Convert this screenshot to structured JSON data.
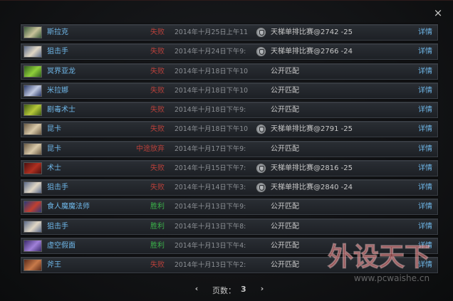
{
  "close_icon": "×",
  "matches": [
    {
      "hero": "斯拉克",
      "result": "失败",
      "result_type": "loss",
      "date": "2014年十月25日上午11:",
      "mode": "天梯单排比赛@2742 -25",
      "ranked": true,
      "detail": "详情",
      "avatar_colors": [
        "#3a5a3a",
        "#c8c29a"
      ]
    },
    {
      "hero": "狙击手",
      "result": "失败",
      "result_type": "loss",
      "date": "2014年十月24日下午9:",
      "mode": "天梯单排比赛@2766 -24",
      "ranked": true,
      "detail": "详情",
      "avatar_colors": [
        "#5a6a8a",
        "#e0d6c4"
      ]
    },
    {
      "hero": "冥界亚龙",
      "result": "失败",
      "result_type": "loss",
      "date": "2014年十月18日下午10",
      "mode": "公开匹配",
      "ranked": false,
      "detail": "详情",
      "avatar_colors": [
        "#2f5e1e",
        "#8fcf3a"
      ]
    },
    {
      "hero": "米拉娜",
      "result": "失败",
      "result_type": "loss",
      "date": "2014年十月18日下午10",
      "mode": "公开匹配",
      "ranked": false,
      "detail": "详情",
      "avatar_colors": [
        "#2a3a6a",
        "#c0c8e0"
      ]
    },
    {
      "hero": "剧毒术士",
      "result": "失败",
      "result_type": "loss",
      "date": "2014年十月18日下午9:",
      "mode": "公开匹配",
      "ranked": false,
      "detail": "详情",
      "avatar_colors": [
        "#3e5a14",
        "#b6c83a"
      ]
    },
    {
      "hero": "昆卡",
      "result": "失败",
      "result_type": "loss",
      "date": "2014年十月18日下午10",
      "mode": "天梯单排比赛@2791 -25",
      "ranked": true,
      "detail": "详情",
      "avatar_colors": [
        "#6a5a44",
        "#d8c8a8"
      ]
    },
    {
      "hero": "昆卡",
      "result": "中途放弃",
      "result_type": "abandon",
      "date": "2014年十月17日下午9:",
      "mode": "公开匹配",
      "ranked": false,
      "detail": "详情",
      "avatar_colors": [
        "#6a5a44",
        "#d8c8a8"
      ]
    },
    {
      "hero": "术士",
      "result": "失败",
      "result_type": "loss",
      "date": "2014年十月15日下午7:",
      "mode": "天梯单排比赛@2816 -25",
      "ranked": true,
      "detail": "详情",
      "avatar_colors": [
        "#4a1010",
        "#b03020"
      ]
    },
    {
      "hero": "狙击手",
      "result": "失败",
      "result_type": "loss",
      "date": "2014年十月14日下午3:",
      "mode": "天梯单排比赛@2840 -24",
      "ranked": true,
      "detail": "详情",
      "avatar_colors": [
        "#5a6a8a",
        "#e0d6c4"
      ]
    },
    {
      "hero": "食人魔魔法师",
      "result": "胜利",
      "result_type": "win",
      "date": "2014年十月13日下午9:",
      "mode": "公开匹配",
      "ranked": false,
      "detail": "详情",
      "avatar_colors": [
        "#2a3a7a",
        "#c04030"
      ]
    },
    {
      "hero": "狙击手",
      "result": "胜利",
      "result_type": "win",
      "date": "2014年十月13日下午8:",
      "mode": "公开匹配",
      "ranked": false,
      "detail": "详情",
      "avatar_colors": [
        "#5a6a8a",
        "#e0d6c4"
      ]
    },
    {
      "hero": "虚空假面",
      "result": "胜利",
      "result_type": "win",
      "date": "2014年十月13日下午4:",
      "mode": "公开匹配",
      "ranked": false,
      "detail": "详情",
      "avatar_colors": [
        "#3a2a6a",
        "#a080d8"
      ]
    },
    {
      "hero": "斧王",
      "result": "失败",
      "result_type": "loss",
      "date": "2014年十月13日下午2:",
      "mode": "公开匹配",
      "ranked": false,
      "detail": "详情",
      "avatar_colors": [
        "#5a2a1a",
        "#c87a4a"
      ]
    }
  ],
  "pager": {
    "prev": "‹",
    "label": "页数：",
    "page": "3",
    "next": "›"
  },
  "watermark": {
    "main": "外设天下",
    "url": "www.pcwaishe.cn"
  },
  "colors": {
    "link": "#6fb8ea",
    "loss": "#b8403a",
    "win": "#3bb34a"
  }
}
